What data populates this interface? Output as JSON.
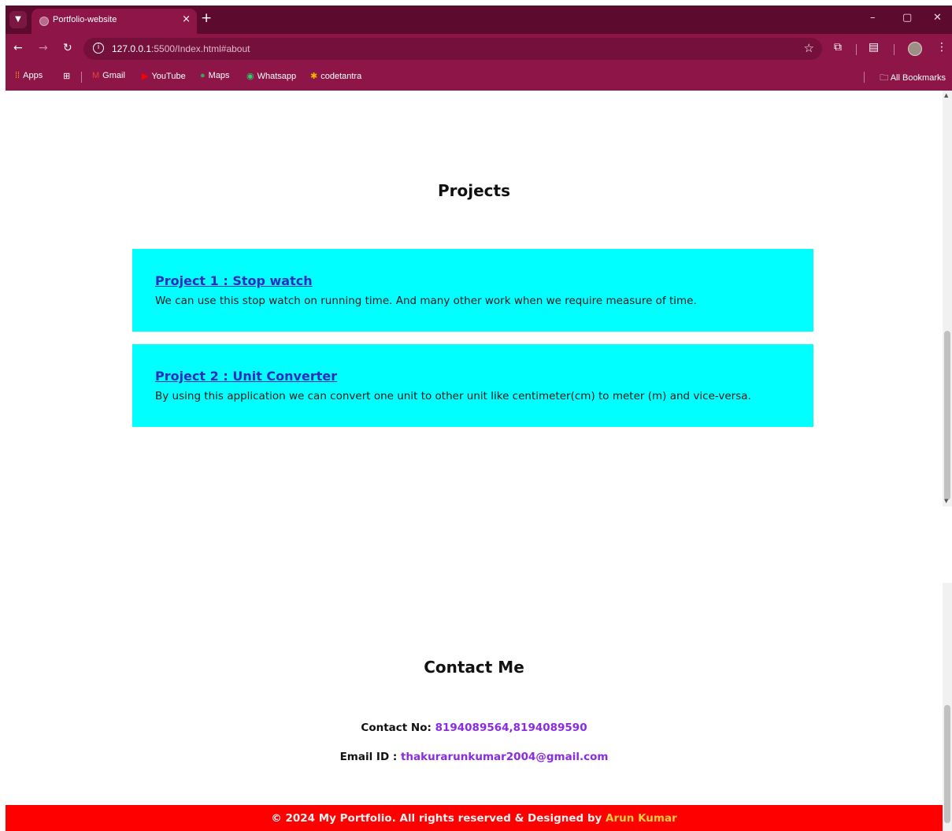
{
  "browser": {
    "tab_title": "Portfolio-website",
    "tab_close": "×",
    "new_tab": "+",
    "url_host": "127.0.0.1",
    "url_rest": ":5500/Index.html#about",
    "window_controls": {
      "minimize": "–",
      "restore": "▢",
      "close": "✕"
    },
    "bookmarks": [
      {
        "label": "Apps",
        "icon": "apps-grid-icon"
      },
      {
        "label": "Gmail",
        "icon": "gmail-icon"
      },
      {
        "label": "YouTube",
        "icon": "youtube-icon"
      },
      {
        "label": "Maps",
        "icon": "maps-icon"
      },
      {
        "label": "Whatsapp",
        "icon": "whatsapp-icon"
      },
      {
        "label": "codetantra",
        "icon": "codetantra-icon"
      }
    ],
    "all_bookmarks": "All Bookmarks"
  },
  "projects": {
    "heading": "Projects",
    "items": [
      {
        "title": "Project 1 : Stop watch",
        "description": "We can use this stop watch on running time. And many other work when we require measure of time."
      },
      {
        "title": "Project 2 : Unit Converter",
        "description": "By using this application we can convert one unit to other unit like centimeter(cm) to meter (m) and vice-versa."
      }
    ]
  },
  "contact": {
    "heading": "Contact Me",
    "phone_label": "Contact No:",
    "phone_value": "8194089564,8194089590",
    "email_label": "Email ID :",
    "email_value": "thakurarunkumar2004@gmail.com"
  },
  "footer": {
    "text": "© 2024 My Portfolio. All rights reserved & Designed by",
    "author": "Arun Kumar"
  },
  "colors": {
    "browser_frame": "#8e1547",
    "tabstrip": "#5c0b2f",
    "project_card": "#00ffff",
    "link": "#2c2cc0",
    "contact_value": "#8a2be2",
    "footer_bg": "#ff0000",
    "footer_author": "#ffcc33"
  }
}
